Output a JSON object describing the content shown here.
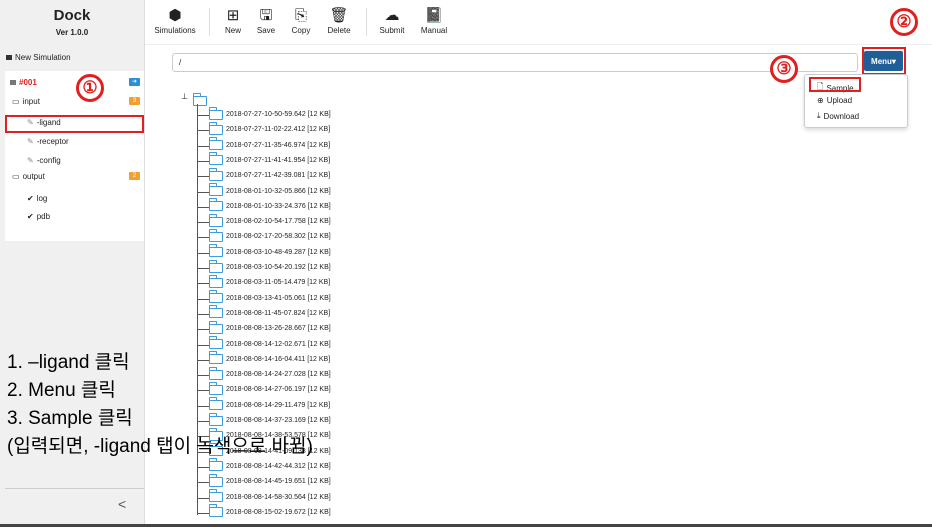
{
  "app": {
    "title": "Dock",
    "version": "Ver 1.0.0"
  },
  "toolbar": [
    {
      "label": "Simulations",
      "icon": "cubes-icon",
      "glyph": "⬢"
    },
    {
      "label": "New",
      "icon": "plus-square-icon",
      "glyph": "⊞"
    },
    {
      "label": "Save",
      "icon": "floppy-icon",
      "glyph": "🖫"
    },
    {
      "label": "Copy",
      "icon": "copy-icon",
      "glyph": "⎘"
    },
    {
      "label": "Delete",
      "icon": "trash-icon",
      "glyph": "🗑"
    },
    {
      "label": "Submit",
      "icon": "cloud-upload-icon",
      "glyph": "☁"
    },
    {
      "label": "Manual",
      "icon": "book-icon",
      "glyph": "📓"
    }
  ],
  "sidebar": {
    "new_sim": "New Simulation",
    "sim_id": "#001",
    "input": "input",
    "input_badge": "3",
    "items": [
      "-ligand",
      "-receptor",
      "-config"
    ],
    "output": "output",
    "output_badge": "2",
    "outputs": [
      "log",
      "pdb"
    ],
    "collapse": "<"
  },
  "path": "/",
  "menu": {
    "label": "Menu▾",
    "items": [
      "Sample",
      "Upload",
      "Download"
    ]
  },
  "markers": [
    "①",
    "②",
    "③"
  ],
  "files": [
    "2018-07-27-10-50-59.642 [12 KB]",
    "2018-07-27-11-02-22.412 [12 KB]",
    "2018-07-27-11-35-46.974 [12 KB]",
    "2018-07-27-11-41-41.954 [12 KB]",
    "2018-07-27-11-42-39.081 [12 KB]",
    "2018-08-01-10-32-05.866 [12 KB]",
    "2018-08-01-10-33-24.376 [12 KB]",
    "2018-08-02-10-54-17.758 [12 KB]",
    "2018-08-02-17-20-58.302 [12 KB]",
    "2018-08-03-10-48-49.287 [12 KB]",
    "2018-08-03-10-54-20.192 [12 KB]",
    "2018-08-03-11-05-14.479 [12 KB]",
    "2018-08-03-13-41-05.061 [12 KB]",
    "2018-08-08-11-45-07.824 [12 KB]",
    "2018-08-08-13-26-28.667 [12 KB]",
    "2018-08-08-14-12-02.671 [12 KB]",
    "2018-08-08-14-16-04.411 [12 KB]",
    "2018-08-08-14-24-27.028 [12 KB]",
    "2018-08-08-14-27-06.197 [12 KB]",
    "2018-08-08-14-29-11.479 [12 KB]",
    "2018-08-08-14-37-23.169 [12 KB]",
    "2018-08-08-14-38-53.578 [12 KB]",
    "2018-08-08-14-41-09.138 [12 KB]",
    "2018-08-08-14-42-44.312 [12 KB]",
    "2018-08-08-14-45-19.651 [12 KB]",
    "2018-08-08-14-58-30.564 [12 KB]",
    "2018-08-08-15-02-19.672 [12 KB]"
  ],
  "instructions": "1. –ligand 클릭\n2. Menu 클릭\n3. Sample 클릭\n(입력되면, -ligand 탭이 녹색으로 바뀜)",
  "colors": {
    "menu_bg": "#1f5e96",
    "highlight": "#e02020",
    "folder": "#3d9be0",
    "sim_id": "#e02020"
  }
}
